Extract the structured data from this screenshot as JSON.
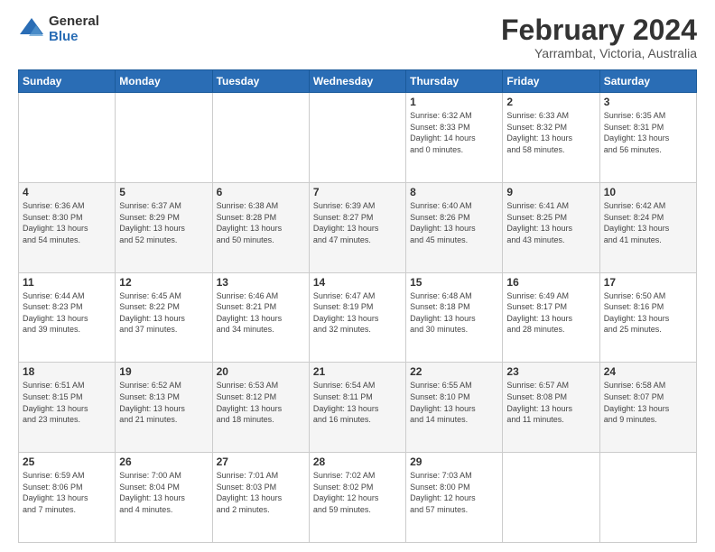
{
  "logo": {
    "general": "General",
    "blue": "Blue"
  },
  "title": "February 2024",
  "location": "Yarrambat, Victoria, Australia",
  "weekdays": [
    "Sunday",
    "Monday",
    "Tuesday",
    "Wednesday",
    "Thursday",
    "Friday",
    "Saturday"
  ],
  "weeks": [
    [
      {
        "day": "",
        "info": ""
      },
      {
        "day": "",
        "info": ""
      },
      {
        "day": "",
        "info": ""
      },
      {
        "day": "",
        "info": ""
      },
      {
        "day": "1",
        "info": "Sunrise: 6:32 AM\nSunset: 8:33 PM\nDaylight: 14 hours\nand 0 minutes."
      },
      {
        "day": "2",
        "info": "Sunrise: 6:33 AM\nSunset: 8:32 PM\nDaylight: 13 hours\nand 58 minutes."
      },
      {
        "day": "3",
        "info": "Sunrise: 6:35 AM\nSunset: 8:31 PM\nDaylight: 13 hours\nand 56 minutes."
      }
    ],
    [
      {
        "day": "4",
        "info": "Sunrise: 6:36 AM\nSunset: 8:30 PM\nDaylight: 13 hours\nand 54 minutes."
      },
      {
        "day": "5",
        "info": "Sunrise: 6:37 AM\nSunset: 8:29 PM\nDaylight: 13 hours\nand 52 minutes."
      },
      {
        "day": "6",
        "info": "Sunrise: 6:38 AM\nSunset: 8:28 PM\nDaylight: 13 hours\nand 50 minutes."
      },
      {
        "day": "7",
        "info": "Sunrise: 6:39 AM\nSunset: 8:27 PM\nDaylight: 13 hours\nand 47 minutes."
      },
      {
        "day": "8",
        "info": "Sunrise: 6:40 AM\nSunset: 8:26 PM\nDaylight: 13 hours\nand 45 minutes."
      },
      {
        "day": "9",
        "info": "Sunrise: 6:41 AM\nSunset: 8:25 PM\nDaylight: 13 hours\nand 43 minutes."
      },
      {
        "day": "10",
        "info": "Sunrise: 6:42 AM\nSunset: 8:24 PM\nDaylight: 13 hours\nand 41 minutes."
      }
    ],
    [
      {
        "day": "11",
        "info": "Sunrise: 6:44 AM\nSunset: 8:23 PM\nDaylight: 13 hours\nand 39 minutes."
      },
      {
        "day": "12",
        "info": "Sunrise: 6:45 AM\nSunset: 8:22 PM\nDaylight: 13 hours\nand 37 minutes."
      },
      {
        "day": "13",
        "info": "Sunrise: 6:46 AM\nSunset: 8:21 PM\nDaylight: 13 hours\nand 34 minutes."
      },
      {
        "day": "14",
        "info": "Sunrise: 6:47 AM\nSunset: 8:19 PM\nDaylight: 13 hours\nand 32 minutes."
      },
      {
        "day": "15",
        "info": "Sunrise: 6:48 AM\nSunset: 8:18 PM\nDaylight: 13 hours\nand 30 minutes."
      },
      {
        "day": "16",
        "info": "Sunrise: 6:49 AM\nSunset: 8:17 PM\nDaylight: 13 hours\nand 28 minutes."
      },
      {
        "day": "17",
        "info": "Sunrise: 6:50 AM\nSunset: 8:16 PM\nDaylight: 13 hours\nand 25 minutes."
      }
    ],
    [
      {
        "day": "18",
        "info": "Sunrise: 6:51 AM\nSunset: 8:15 PM\nDaylight: 13 hours\nand 23 minutes."
      },
      {
        "day": "19",
        "info": "Sunrise: 6:52 AM\nSunset: 8:13 PM\nDaylight: 13 hours\nand 21 minutes."
      },
      {
        "day": "20",
        "info": "Sunrise: 6:53 AM\nSunset: 8:12 PM\nDaylight: 13 hours\nand 18 minutes."
      },
      {
        "day": "21",
        "info": "Sunrise: 6:54 AM\nSunset: 8:11 PM\nDaylight: 13 hours\nand 16 minutes."
      },
      {
        "day": "22",
        "info": "Sunrise: 6:55 AM\nSunset: 8:10 PM\nDaylight: 13 hours\nand 14 minutes."
      },
      {
        "day": "23",
        "info": "Sunrise: 6:57 AM\nSunset: 8:08 PM\nDaylight: 13 hours\nand 11 minutes."
      },
      {
        "day": "24",
        "info": "Sunrise: 6:58 AM\nSunset: 8:07 PM\nDaylight: 13 hours\nand 9 minutes."
      }
    ],
    [
      {
        "day": "25",
        "info": "Sunrise: 6:59 AM\nSunset: 8:06 PM\nDaylight: 13 hours\nand 7 minutes."
      },
      {
        "day": "26",
        "info": "Sunrise: 7:00 AM\nSunset: 8:04 PM\nDaylight: 13 hours\nand 4 minutes."
      },
      {
        "day": "27",
        "info": "Sunrise: 7:01 AM\nSunset: 8:03 PM\nDaylight: 13 hours\nand 2 minutes."
      },
      {
        "day": "28",
        "info": "Sunrise: 7:02 AM\nSunset: 8:02 PM\nDaylight: 12 hours\nand 59 minutes."
      },
      {
        "day": "29",
        "info": "Sunrise: 7:03 AM\nSunset: 8:00 PM\nDaylight: 12 hours\nand 57 minutes."
      },
      {
        "day": "",
        "info": ""
      },
      {
        "day": "",
        "info": ""
      }
    ]
  ]
}
